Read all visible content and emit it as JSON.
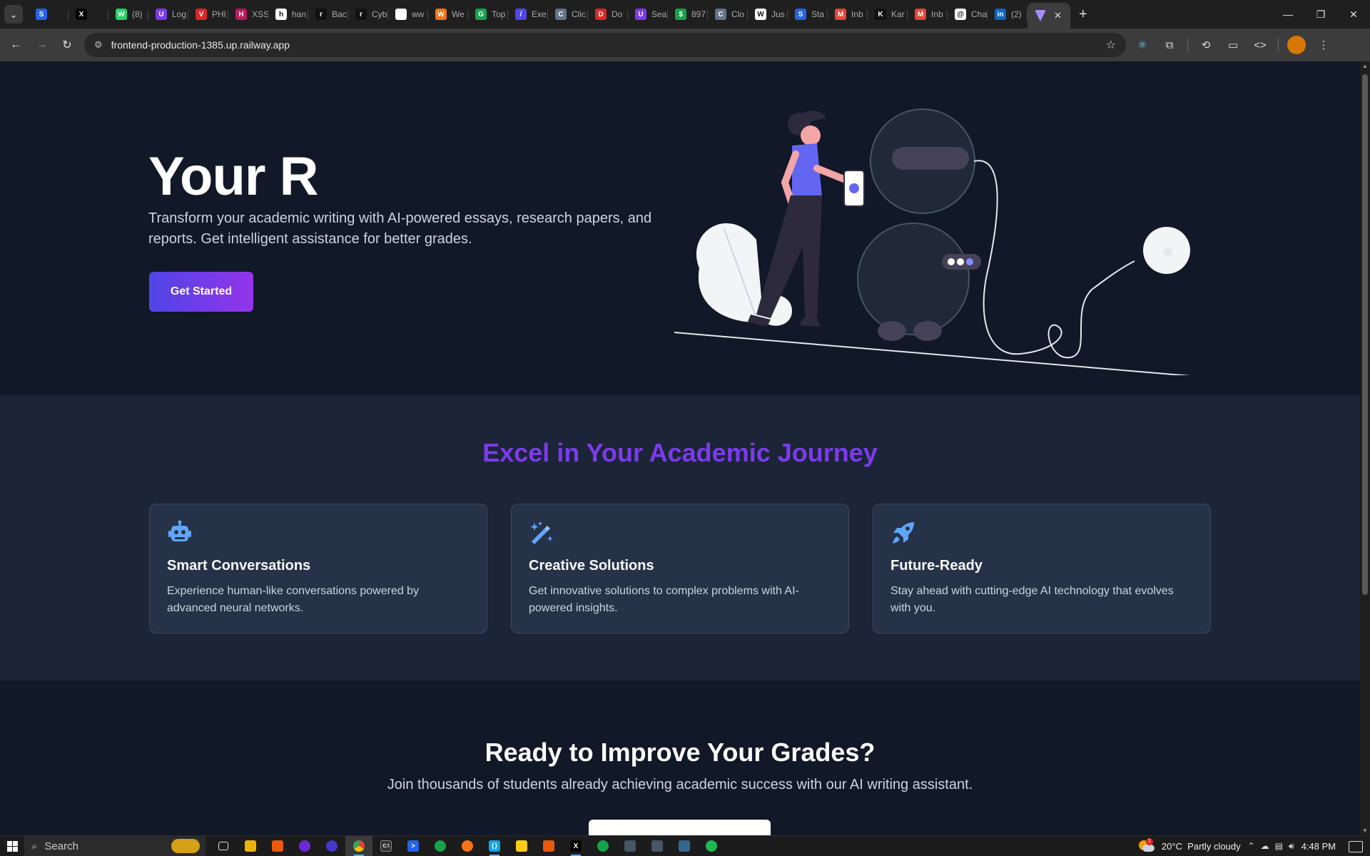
{
  "browser": {
    "tabs": [
      {
        "title": "",
        "color": "#2563eb",
        "glyph": "S"
      },
      {
        "title": "",
        "color": "#000000",
        "glyph": "X"
      },
      {
        "title": "(8)",
        "color": "#25d366",
        "glyph": "W"
      },
      {
        "title": "Log",
        "color": "#7c3aed",
        "glyph": "U"
      },
      {
        "title": "PHI",
        "color": "#dc2626",
        "glyph": "V"
      },
      {
        "title": "XSS",
        "color": "#be185d",
        "glyph": "H"
      },
      {
        "title": "han",
        "color": "#ffffff",
        "glyph": "h"
      },
      {
        "title": "Bac",
        "color": "#111111",
        "glyph": "r"
      },
      {
        "title": "Cyb",
        "color": "#111111",
        "glyph": "r"
      },
      {
        "title": "ww",
        "color": "#ffffff",
        "glyph": ""
      },
      {
        "title": "We",
        "color": "#f97316",
        "glyph": "W"
      },
      {
        "title": "Top",
        "color": "#16a34a",
        "glyph": "G"
      },
      {
        "title": "Exe",
        "color": "#4f46e5",
        "glyph": "/"
      },
      {
        "title": "Clic",
        "color": "#64748b",
        "glyph": "C"
      },
      {
        "title": "Do",
        "color": "#dc2626",
        "glyph": "D"
      },
      {
        "title": "Sea",
        "color": "#7c3aed",
        "glyph": "U"
      },
      {
        "title": "897",
        "color": "#16a34a",
        "glyph": "$"
      },
      {
        "title": "Clo",
        "color": "#64748b",
        "glyph": "C"
      },
      {
        "title": "Jus",
        "color": "#ffffff",
        "glyph": "W"
      },
      {
        "title": "Sta",
        "color": "#2563eb",
        "glyph": "S"
      },
      {
        "title": "Inb",
        "color": "#ea4335",
        "glyph": "M"
      },
      {
        "title": "Kar",
        "color": "#111111",
        "glyph": "K"
      },
      {
        "title": "Inb",
        "color": "#ea4335",
        "glyph": "M"
      },
      {
        "title": "Cha",
        "color": "#ffffff",
        "glyph": "@"
      },
      {
        "title": "(2)",
        "color": "#0a66c2",
        "glyph": "in"
      }
    ],
    "active_tab": {
      "title": "",
      "color": "#a78bfa"
    },
    "url": "frontend-production-1385.up.railway.app"
  },
  "hero": {
    "title": "Your R",
    "subtitle": "Transform your academic writing with AI-powered essays, research papers, and reports. Get intelligent assistance for better grades.",
    "cta_label": "Get Started"
  },
  "features": {
    "title": "Excel in Your Academic Journey",
    "cards": [
      {
        "icon": "robot-icon",
        "title": "Smart Conversations",
        "desc": "Experience human-like conversations powered by advanced neural networks."
      },
      {
        "icon": "magic-wand-icon",
        "title": "Creative Solutions",
        "desc": "Get innovative solutions to complex problems with AI-powered insights."
      },
      {
        "icon": "rocket-icon",
        "title": "Future-Ready",
        "desc": "Stay ahead with cutting-edge AI technology that evolves with you."
      }
    ]
  },
  "cta": {
    "title": "Ready to Improve Your Grades?",
    "subtitle": "Join thousands of students already achieving academic success with our AI writing assistant."
  },
  "taskbar": {
    "search_placeholder": "Search",
    "weather": "20°C  Partly cloudy",
    "weather_badge": "1",
    "time": "4:48 PM"
  },
  "colors": {
    "accent": "#7c3aed",
    "icon": "#60a5fa",
    "button_gradient_start": "#4f46e5",
    "button_gradient_end": "#9333ea"
  }
}
